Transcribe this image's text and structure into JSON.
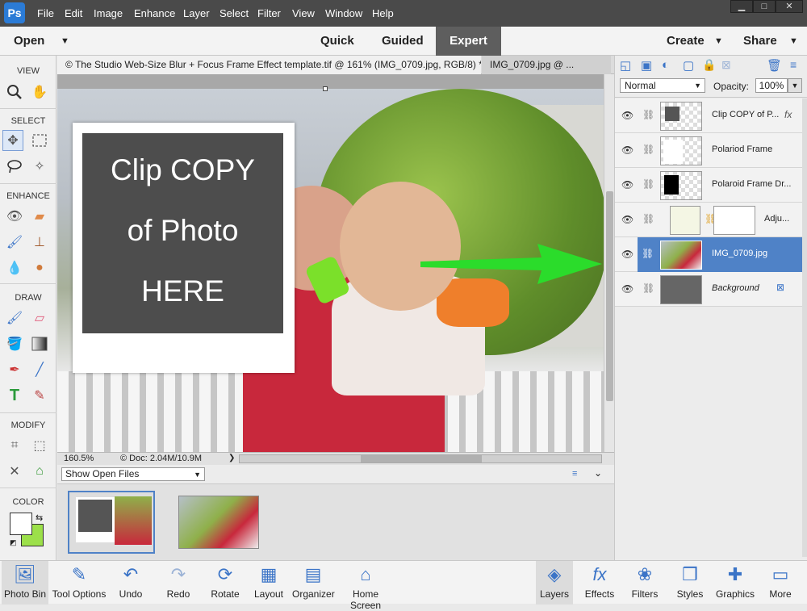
{
  "app": {
    "logo": "Ps"
  },
  "menu": [
    "File",
    "Edit",
    "Image",
    "Enhance",
    "Layer",
    "Select",
    "Filter",
    "View",
    "Window",
    "Help"
  ],
  "window_controls": [
    "▁",
    "□",
    "✕"
  ],
  "modes": {
    "open": "Open",
    "quick": "Quick",
    "guided": "Guided",
    "expert": "Expert",
    "create": "Create",
    "share": "Share"
  },
  "toolbox": {
    "view": "VIEW",
    "select": "SELECT",
    "enhance": "ENHANCE",
    "draw": "DRAW",
    "modify": "MODIFY",
    "color": "COLOR"
  },
  "tabs": [
    "© The Studio Web-Size Blur + Focus Frame Effect template.tif @ 161% (IMG_0709.jpg, RGB/8) *",
    "IMG_0709.jpg @ ..."
  ],
  "polaroid_text": [
    "Clip COPY",
    "of Photo",
    "HERE"
  ],
  "status": {
    "zoom": "160.5%",
    "doc": "© Doc: 2.04M/10.9M"
  },
  "bin": {
    "dropdown": "Show Open Files"
  },
  "layers_panel": {
    "blend_mode": "Normal",
    "opacity_label": "Opacity:",
    "opacity_value": "100%",
    "layers": [
      {
        "name": "Clip COPY of P...",
        "fx": "fx"
      },
      {
        "name": "Polariod Frame"
      },
      {
        "name": "Polaroid Frame Dr..."
      },
      {
        "name": "Adju..."
      },
      {
        "name": "IMG_0709.jpg",
        "selected": true
      },
      {
        "name": "Background",
        "italic": true
      }
    ]
  },
  "bottom": [
    {
      "label": "Photo Bin",
      "icon": "photo-bin-icon",
      "active": true
    },
    {
      "label": "Tool Options",
      "icon": "tool-options-icon"
    },
    {
      "label": "Undo",
      "icon": "undo-icon"
    },
    {
      "label": "Redo",
      "icon": "redo-icon"
    },
    {
      "label": "Rotate",
      "icon": "rotate-icon"
    },
    {
      "label": "Layout",
      "icon": "layout-icon"
    },
    {
      "label": "Organizer",
      "icon": "organizer-icon"
    },
    {
      "label": "Home Screen",
      "icon": "home-icon"
    },
    {
      "label": "Layers",
      "icon": "layers-icon",
      "active": true
    },
    {
      "label": "Effects",
      "icon": "effects-icon"
    },
    {
      "label": "Filters",
      "icon": "filters-icon"
    },
    {
      "label": "Styles",
      "icon": "styles-icon"
    },
    {
      "label": "Graphics",
      "icon": "graphics-icon"
    },
    {
      "label": "More",
      "icon": "more-icon"
    }
  ],
  "colors": {
    "arrow": "#2bdc2b",
    "selected_layer": "#4f82c7",
    "accent": "#3b74c7",
    "background_swatch": "#9ce04a"
  }
}
